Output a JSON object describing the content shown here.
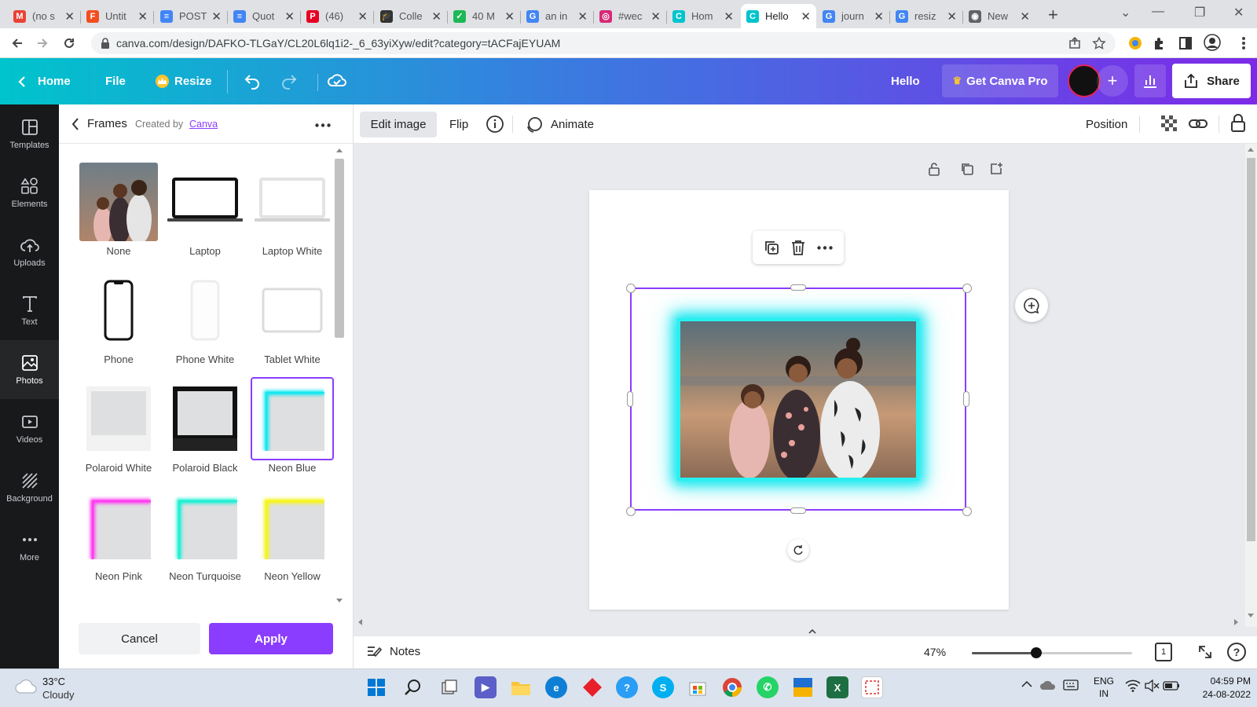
{
  "browser": {
    "tabs": [
      {
        "title": "(no s",
        "icon": "gmail-icon",
        "color": "#ea4335",
        "glyph": "M"
      },
      {
        "title": "Untit",
        "icon": "figma-icon",
        "color": "#f24e1e",
        "glyph": "F"
      },
      {
        "title": "POST",
        "icon": "google-docs-icon",
        "color": "#4285f4",
        "glyph": "≡"
      },
      {
        "title": "Quot",
        "icon": "google-docs-icon",
        "color": "#4285f4",
        "glyph": "≡"
      },
      {
        "title": "(46)",
        "icon": "pinterest-icon",
        "color": "#e60023",
        "glyph": "P"
      },
      {
        "title": "Colle",
        "icon": "graduation-cap-icon",
        "color": "#333333",
        "glyph": "🎓"
      },
      {
        "title": "40 M",
        "icon": "checkmark-icon",
        "color": "#1db954",
        "glyph": "✓"
      },
      {
        "title": "an in",
        "icon": "google-icon",
        "color": "#4285f4",
        "glyph": "G"
      },
      {
        "title": "#wec",
        "icon": "instagram-icon",
        "color": "#d62976",
        "glyph": "◎"
      },
      {
        "title": "Hom",
        "icon": "canva-icon",
        "color": "#00c4cc",
        "glyph": "C"
      },
      {
        "title": "Hello",
        "icon": "canva-icon",
        "color": "#00c4cc",
        "glyph": "C",
        "active": true
      },
      {
        "title": "journ",
        "icon": "google-icon",
        "color": "#4285f4",
        "glyph": "G"
      },
      {
        "title": "resiz",
        "icon": "google-icon",
        "color": "#4285f4",
        "glyph": "G"
      },
      {
        "title": "New",
        "icon": "chrome-icon",
        "color": "#5f6368",
        "glyph": "◉"
      }
    ],
    "new_tab": "+",
    "url": "canva.com/design/DAFKO-TLGaY/CL20L6lq1i2-_6_63yiXyw/edit?category=tACFajEYUAM"
  },
  "header": {
    "home": "Home",
    "file": "File",
    "resize": "Resize",
    "design_title": "Hello",
    "get_pro": "Get Canva Pro",
    "share": "Share"
  },
  "rail": [
    {
      "label": "Templates",
      "icon": "templates-icon"
    },
    {
      "label": "Elements",
      "icon": "elements-icon"
    },
    {
      "label": "Uploads",
      "icon": "uploads-icon"
    },
    {
      "label": "Text",
      "icon": "text-icon"
    },
    {
      "label": "Photos",
      "icon": "photos-icon",
      "active": true
    },
    {
      "label": "Videos",
      "icon": "videos-icon"
    },
    {
      "label": "Background",
      "icon": "background-icon"
    },
    {
      "label": "More",
      "icon": "more-icon"
    }
  ],
  "panel": {
    "title": "Frames",
    "created_by": "Created by",
    "creator": "Canva",
    "frames": [
      {
        "label": "None",
        "kind": "photo"
      },
      {
        "label": "Laptop",
        "kind": "laptop"
      },
      {
        "label": "Laptop White",
        "kind": "laptop-white"
      },
      {
        "label": "Phone",
        "kind": "phone"
      },
      {
        "label": "Phone White",
        "kind": "phone-white"
      },
      {
        "label": "Tablet White",
        "kind": "tablet-white"
      },
      {
        "label": "Polaroid White",
        "kind": "polaroid-white"
      },
      {
        "label": "Polaroid Black",
        "kind": "polaroid-black"
      },
      {
        "label": "Neon Blue",
        "kind": "neon",
        "color": "#15e8f0",
        "selected": true
      },
      {
        "label": "Neon Pink",
        "kind": "neon",
        "color": "#ff3cf0"
      },
      {
        "label": "Neon Turquoise",
        "kind": "neon",
        "color": "#1ef0d2"
      },
      {
        "label": "Neon Yellow",
        "kind": "neon",
        "color": "#f5f51e"
      }
    ],
    "cancel": "Cancel",
    "apply": "Apply"
  },
  "toolbar": {
    "edit_image": "Edit image",
    "flip": "Flip",
    "animate": "Animate",
    "position": "Position"
  },
  "bottom": {
    "notes": "Notes",
    "zoom": "47%",
    "zoom_fraction": 0.4,
    "page_count": "1"
  },
  "taskbar": {
    "temp": "33°C",
    "weather": "Cloudy",
    "lang": "ENG",
    "region": "IN",
    "time": "04:59 PM",
    "date": "24-08-2022"
  },
  "colors": {
    "accent": "#8b3dff",
    "neon_blue": "#15e8f0",
    "header_start": "#00c4cc",
    "header_end": "#7d2ae8"
  }
}
